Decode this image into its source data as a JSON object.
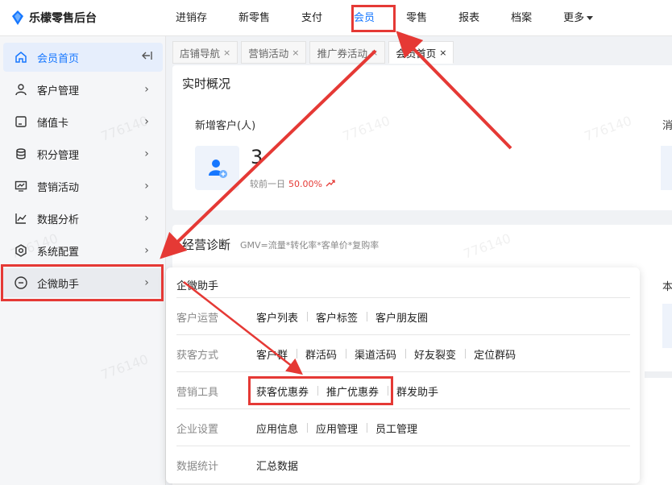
{
  "app": {
    "name": "乐檬零售后台"
  },
  "topnav": {
    "items": [
      "进销存",
      "新零售",
      "支付",
      "会员",
      "零售",
      "报表",
      "档案"
    ],
    "more": "更多",
    "active": "会员"
  },
  "sidebar": {
    "items": [
      {
        "label": "会员首页",
        "icon": "home-icon"
      },
      {
        "label": "客户管理",
        "icon": "user-icon"
      },
      {
        "label": "储值卡",
        "icon": "card-icon"
      },
      {
        "label": "积分管理",
        "icon": "coins-icon"
      },
      {
        "label": "营销活动",
        "icon": "monitor-icon"
      },
      {
        "label": "数据分析",
        "icon": "line-chart-icon"
      },
      {
        "label": "系统配置",
        "icon": "settings-icon"
      },
      {
        "label": "企微助手",
        "icon": "chat-bubble-icon"
      }
    ]
  },
  "tabs": [
    {
      "label": "店铺导航",
      "close": "×"
    },
    {
      "label": "营销活动",
      "close": "×"
    },
    {
      "label": "推广券活动",
      "close": "×"
    },
    {
      "label": "会员首页",
      "close": "×"
    }
  ],
  "realtime": {
    "title": "实时概况",
    "metric_label": "新增客户(人)",
    "metric_value": "3",
    "compare_label": "较前一日",
    "compare_rate": "50.00%",
    "cut_label": "消"
  },
  "business": {
    "title": "经营诊断",
    "formula": "GMV=流量*转化率*客单价*复购率",
    "cut_label": "本"
  },
  "popup": {
    "title": "企微助手",
    "rows": [
      {
        "category": "客户运营",
        "links": [
          "客户列表",
          "客户标签",
          "客户朋友圈"
        ]
      },
      {
        "category": "获客方式",
        "links": [
          "客户群",
          "群活码",
          "渠道活码",
          "好友裂变",
          "定位群码"
        ]
      },
      {
        "category": "营销工具",
        "links": [
          "获客优惠券",
          "推广优惠券",
          "群发助手"
        ]
      },
      {
        "category": "企业设置",
        "links": [
          "应用信息",
          "应用管理",
          "员工管理"
        ]
      },
      {
        "category": "数据统计",
        "links": [
          "汇总数据"
        ]
      }
    ]
  },
  "watermark": "776140",
  "colors": {
    "accent": "#1677ff",
    "highlight": "#e53935",
    "trend_up": "#e53935"
  }
}
